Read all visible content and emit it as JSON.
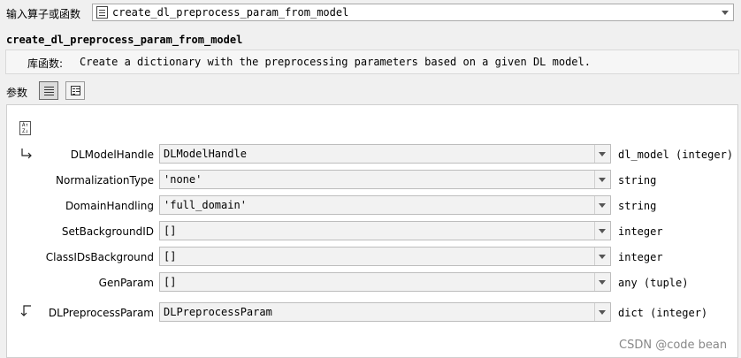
{
  "operator_selector": {
    "label": "输入算子或函数",
    "value": "create_dl_preprocess_param_from_model",
    "icon": "document-list-icon"
  },
  "operator": {
    "name": "create_dl_preprocess_param_from_model",
    "description_label": "库函数:",
    "description": "Create a dictionary with the preprocessing parameters based on a given DL model."
  },
  "params_toolbar": {
    "label": "参数",
    "view_buttons": [
      "list-view-icon",
      "detail-view-icon"
    ]
  },
  "sort_icon": "sort-az-icon",
  "params": [
    {
      "name": "DLModelHandle",
      "value": "DLModelHandle",
      "type": "dl_model (integer)",
      "direction": "input"
    },
    {
      "name": "NormalizationType",
      "value": "'none'",
      "type": "string",
      "direction": ""
    },
    {
      "name": "DomainHandling",
      "value": "'full_domain'",
      "type": "string",
      "direction": ""
    },
    {
      "name": "SetBackgroundID",
      "value": "[]",
      "type": "integer",
      "direction": ""
    },
    {
      "name": "ClassIDsBackground",
      "value": "[]",
      "type": "integer",
      "direction": ""
    },
    {
      "name": "GenParam",
      "value": "[]",
      "type": "any (tuple)",
      "direction": ""
    },
    {
      "name": "DLPreprocessParam",
      "value": "DLPreprocessParam",
      "type": "dict (integer)",
      "direction": "output"
    }
  ],
  "watermark": "CSDN @code bean",
  "colors": {
    "background": "#f0f0f0",
    "panel": "#ffffff",
    "field": "#f2f2f2",
    "border": "#bdbdbd"
  }
}
